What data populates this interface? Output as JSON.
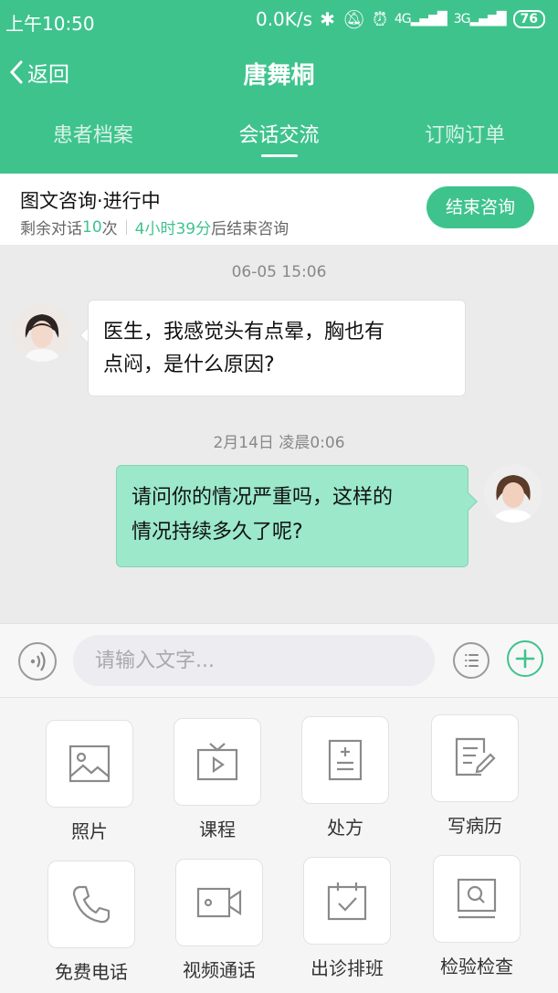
{
  "status": {
    "time": "上午10:50",
    "speed": "0.0K/s",
    "net1": "4G",
    "net2": "3G",
    "battery": "76"
  },
  "nav": {
    "back_label": "返回",
    "title": "唐舞桐"
  },
  "tabs": [
    {
      "label": "患者档案"
    },
    {
      "label": "会话交流"
    },
    {
      "label": "订购订单"
    }
  ],
  "consult": {
    "title": "图文咨询·进行中",
    "remaining_prefix": "剩余对话",
    "remaining_count": "10",
    "remaining_suffix": "次",
    "time_left": "4小时39分",
    "time_suffix": "后结束咨询",
    "end_button": "结束咨询"
  },
  "messages": [
    {
      "time": "06-05 15:06",
      "line1": "医生，我感觉头有点晕，胸也有",
      "line2": "点闷，是什么原因?"
    },
    {
      "time": "2月14日 凌晨0:06",
      "line1": "请问你的情况严重吗，这样的",
      "line2": "情况持续多久了呢?"
    }
  ],
  "input": {
    "placeholder": "请输入文字..."
  },
  "tools": [
    {
      "label": "照片",
      "icon": "photo-icon"
    },
    {
      "label": "课程",
      "icon": "video-play-icon"
    },
    {
      "label": "处方",
      "icon": "prescription-icon"
    },
    {
      "label": "写病历",
      "icon": "edit-record-icon"
    },
    {
      "label": "免费电话",
      "icon": "phone-icon"
    },
    {
      "label": "视频通话",
      "icon": "video-call-icon"
    },
    {
      "label": "出诊排班",
      "icon": "calendar-check-icon"
    },
    {
      "label": "检验检查",
      "icon": "search-report-icon"
    }
  ],
  "colors": {
    "brand": "#3ec38d",
    "bubble_self": "#9be8cb"
  }
}
